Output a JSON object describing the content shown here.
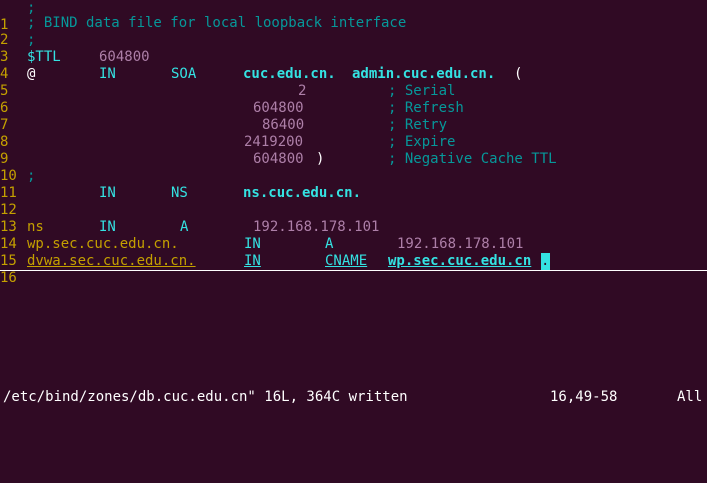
{
  "lines": [
    {
      "n": "1",
      "comment": ";"
    },
    {
      "n": "2",
      "comment": "; BIND data file for local loopback interface"
    },
    {
      "n": "3",
      "comment": ";"
    },
    {
      "n": "4",
      "ttl_kw": "$TTL",
      "ttl_val": "604800"
    },
    {
      "n": "5",
      "at": "@",
      "class": "IN",
      "type": "SOA",
      "name": "cuc.edu.cn.",
      "admin": "admin.cuc.edu.cn.",
      "paren": "("
    },
    {
      "n": "6",
      "value": "2",
      "comment": "; Serial"
    },
    {
      "n": "7",
      "value": "604800",
      "comment": "; Refresh"
    },
    {
      "n": "8",
      "value": "86400",
      "comment": "; Retry"
    },
    {
      "n": "9",
      "value": "2419200",
      "comment": "; Expire"
    },
    {
      "n": "10",
      "value": "604800",
      "close": ")",
      "comment": "; Negative Cache TTL"
    },
    {
      "n": "11",
      "comment": ";"
    },
    {
      "n": "12",
      "class": "IN",
      "type": "NS",
      "target": "ns.cuc.edu.cn."
    },
    {
      "n": "13"
    },
    {
      "n": "14",
      "name": "ns",
      "class": "IN",
      "type": "A",
      "ip": "192.168.178.101"
    },
    {
      "n": "15",
      "name": "wp.sec.cuc.edu.cn.",
      "class": "IN",
      "type": "A",
      "ip": "192.168.178.101"
    },
    {
      "n": "16",
      "name": "dvwa.sec.cuc.edu.cn.",
      "class": "IN",
      "type": "CNAME",
      "target": "wp.sec.cuc.edu.cn",
      "cursor_char": "."
    }
  ],
  "status": {
    "message": "/etc/bind/zones/db.cuc.edu.cn\" 16L, 364C written",
    "position": "16,49-58",
    "scroll": "All"
  }
}
